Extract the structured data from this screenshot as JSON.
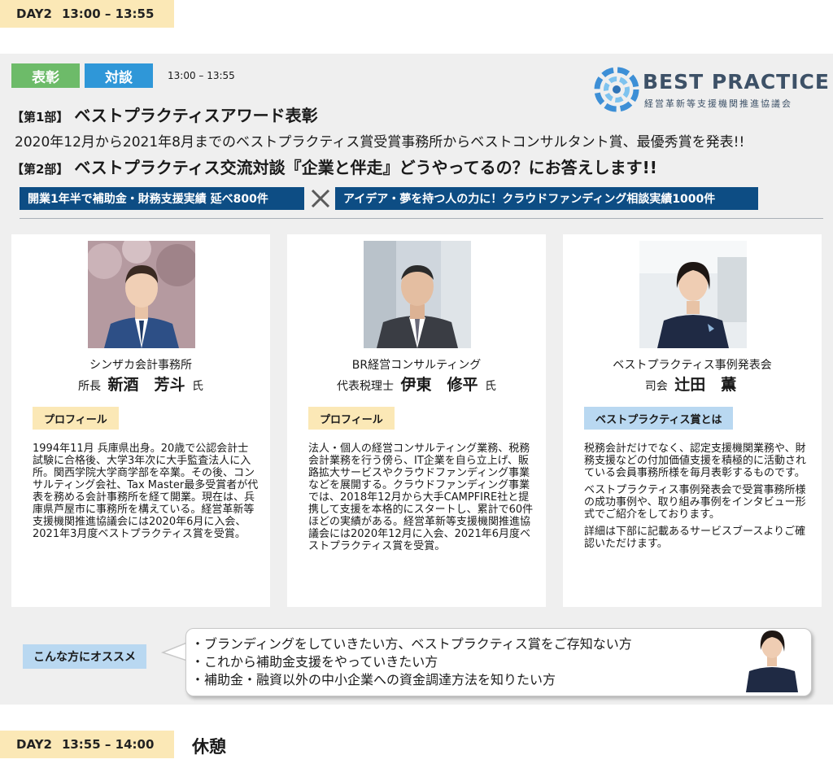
{
  "day_top": {
    "label": "DAY2",
    "time": "13:00 – 13:55"
  },
  "day_bottom": {
    "label": "DAY2",
    "time": "13:55 – 14:00"
  },
  "break_title": "休憩",
  "tags": {
    "award": "表彰",
    "talk": "対談",
    "time": "13:00 – 13:55"
  },
  "logo": {
    "line1": "BEST PRACTICE",
    "line2": "経営革新等支援機関推進協議会"
  },
  "part1": {
    "tag": "【第1部】",
    "title": "ベストプラクティスアワード表彰"
  },
  "award_desc": "2020年12月から2021年8月までのベストプラクティス賞受賞事務所からベストコンサルタント賞、最優秀賞を発表!!",
  "part2": {
    "tag": "【第2部】",
    "title": "ベストプラクティス交流対談『企業と伴走』どうやってるの？にお答えします!!"
  },
  "band_left": "開業1年半で補助金・財務支援実績 延べ800件",
  "band_right": "アイデア・夢を持つ人の力に！クラウドファンディング相談実績1000件",
  "cards": [
    {
      "org": "シンザカ会計事務所",
      "role": "所長",
      "name": "新酒　芳斗",
      "suffix": "氏",
      "chip": "プロフィール",
      "paragraphs": [
        "1994年11月 兵庫県出身。20歳で公認会計士試験に合格後、大学3年次に大手監査法人に入所。関西学院大学商学部を卒業。その後、コンサルティング会社、Tax Master最多受賞者が代表を務める会計事務所を経て開業。現在は、兵庫県芦屋市に事務所を構えている。経営革新等支援機関推進協議会には2020年6月に入会、2021年3月度ベストプラクティス賞を受賞。"
      ]
    },
    {
      "org": "BR経営コンサルティング",
      "role": "代表税理士",
      "name": "伊東　修平",
      "suffix": "氏",
      "chip": "プロフィール",
      "paragraphs": [
        "法人・個人の経営コンサルティング業務、税務会計業務を行う傍ら、IT企業を自ら立上げ、販路拡大サービスやクラウドファンディング事業などを展開する。クラウドファンディング事業では、2018年12月から大手CAMPFIRE社と提携して支援を本格的にスタートし、累計で60件ほどの実績がある。経営革新等支援機関推進協議会には2020年12月に入会、2021年6月度ベストプラクティス賞を受賞。"
      ]
    },
    {
      "org": "ベストプラクティス事例発表会",
      "role": "司会",
      "name": "辻田　薫",
      "suffix": "",
      "chip": "ベストプラクティス賞とは",
      "paragraphs": [
        "税務会計だけでなく、認定支援機関業務や、財務支援などの付加価値支援を積極的に活動されている会員事務所様を毎月表彰するものです。",
        "ベストプラクティス事例発表会で受賞事務所様の成功事例や、取り組み事例をインタビュー形式でご紹介をしております。",
        "詳細は下部に記載あるサービスブースよりご確認いただけます。"
      ]
    }
  ],
  "recommend": {
    "label": "こんな方にオススメ",
    "items": [
      "・ブランディングをしていきたい方、ベストプラクティス賞をご存知ない方",
      "・これから補助金支援をやっていきたい方",
      "・補助金・融資以外の中小企業への資金調達方法を知りたい方"
    ]
  },
  "colors": {
    "award_tag": "#6dbb69",
    "talk_tag": "#2f97d8",
    "band": "#0d4d84",
    "day_bar": "#fbe8b6",
    "chip_blue": "#b9d8f1"
  }
}
